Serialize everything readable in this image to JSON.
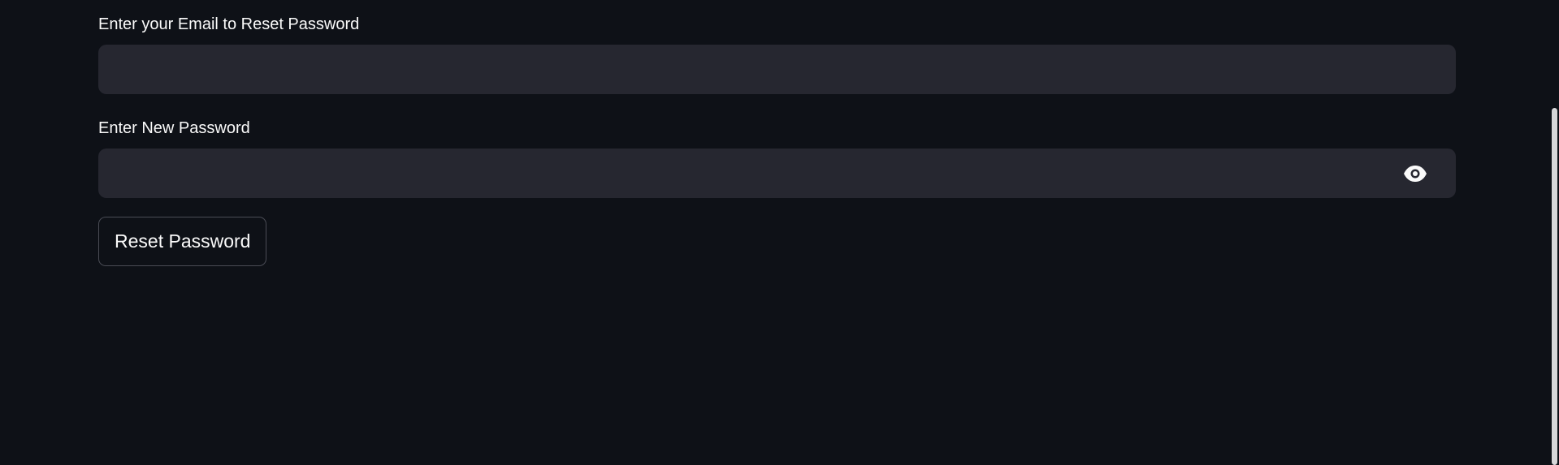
{
  "form": {
    "email_label": "Enter your Email to Reset Password",
    "email_value": "",
    "password_label": "Enter New Password",
    "password_value": "",
    "reset_button_label": "Reset Password",
    "password_toggle_icon": "eye-icon"
  },
  "theme": {
    "background": "#0e1117",
    "input_background": "#262730",
    "text": "#fafafa",
    "button_border": "#4a4c55"
  }
}
